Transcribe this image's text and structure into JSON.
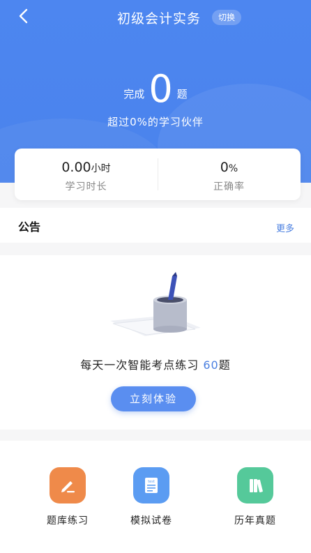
{
  "header": {
    "title": "初级会计实务",
    "switch_label": "切换"
  },
  "progress": {
    "prefix": "完成",
    "count": "0",
    "suffix": "题",
    "beat_text": "超过0%的学习伙伴"
  },
  "stats": [
    {
      "value": "0.00",
      "unit": "小时",
      "label": "学习时长"
    },
    {
      "value": "0",
      "unit": "%",
      "label": "正确率"
    }
  ],
  "notice": {
    "title": "公告",
    "more": "更多"
  },
  "daily": {
    "text_before": "每天一次智能考点练习",
    "count": "60",
    "text_after": "题",
    "cta": "立刻体验"
  },
  "entries": [
    {
      "label": "题库练习",
      "color": "#ef8a4a",
      "icon": "pen-icon"
    },
    {
      "label": "模拟试卷",
      "color": "#5b9cf2",
      "icon": "test-paper-icon",
      "icon_text": "test"
    },
    {
      "label": "历年真题",
      "color": "#55c99a",
      "icon": "books-icon"
    }
  ]
}
